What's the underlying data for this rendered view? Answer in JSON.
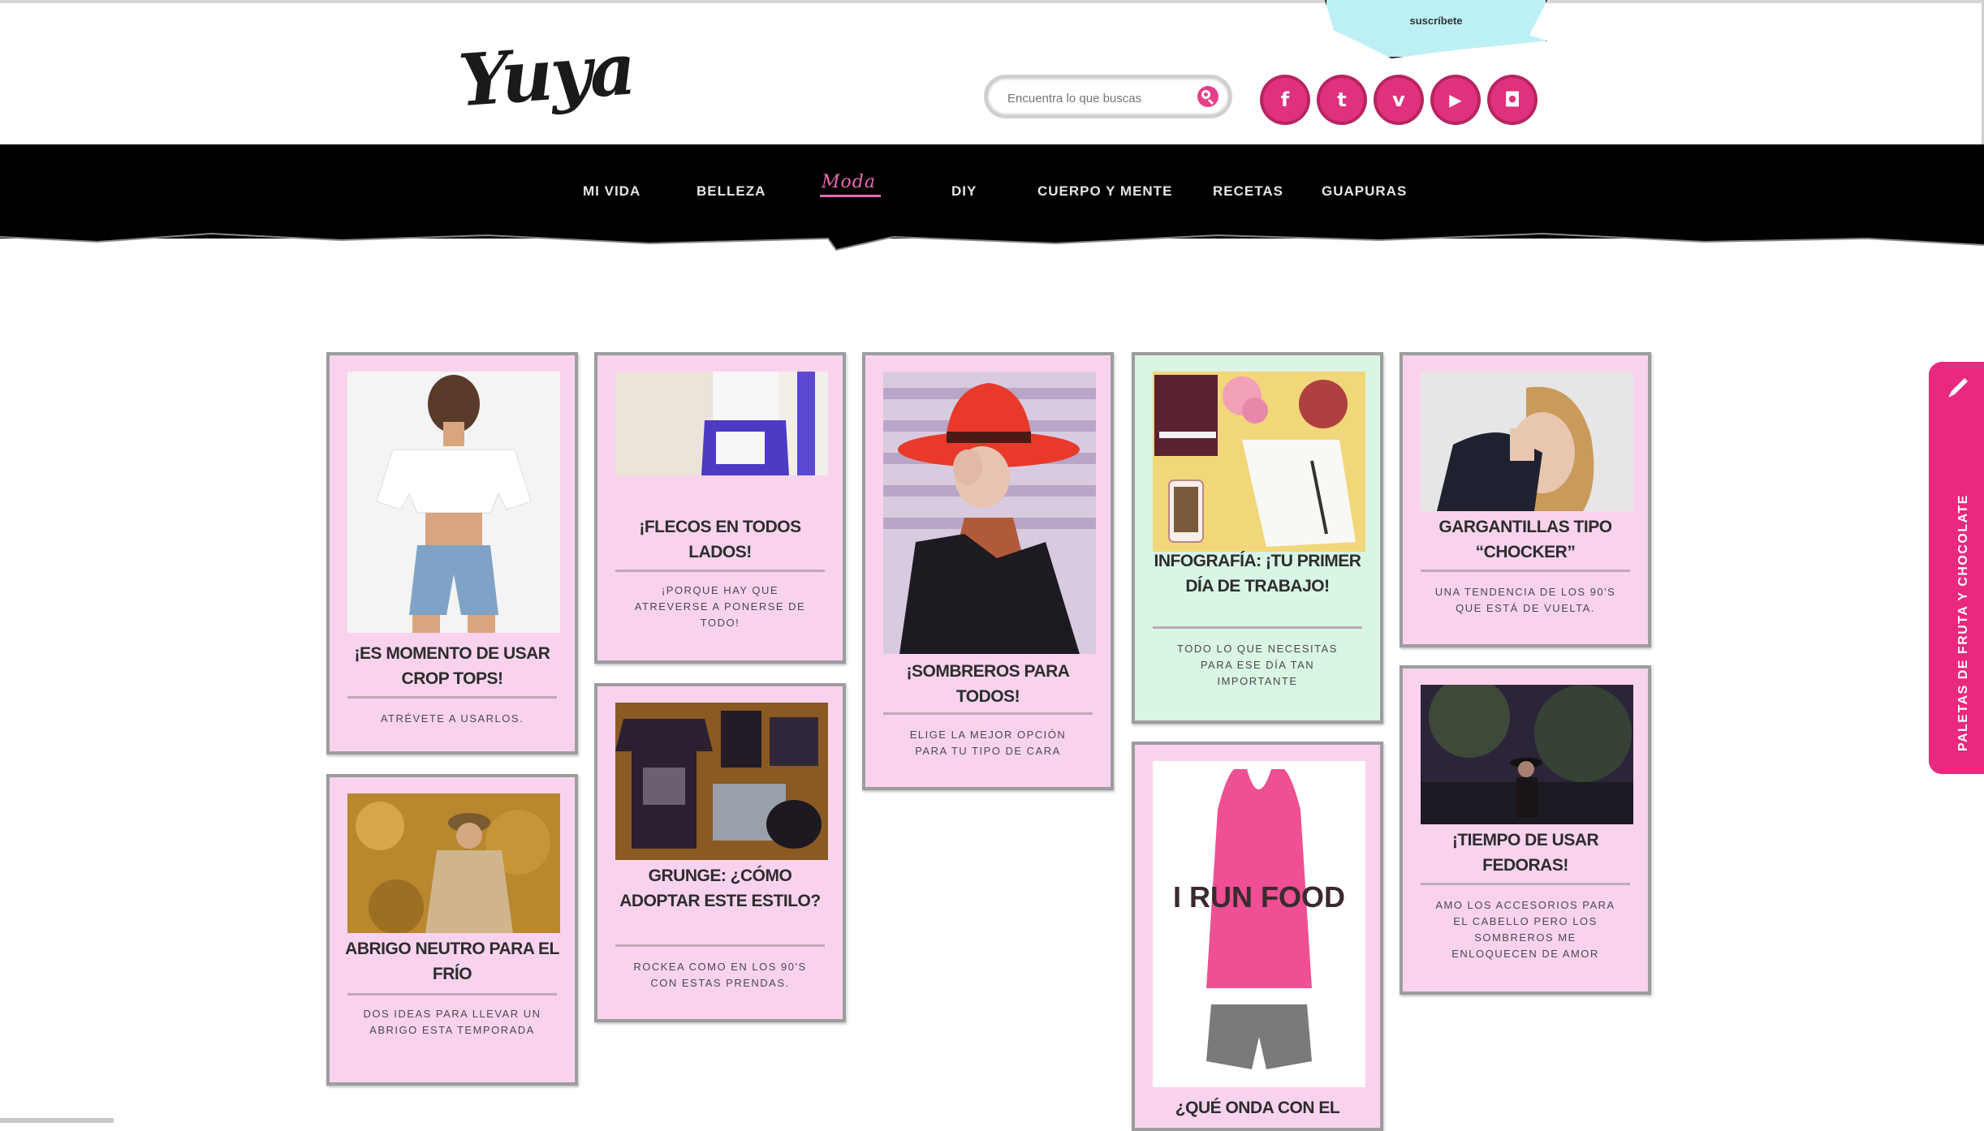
{
  "header": {
    "logo_text": "Yuya",
    "ribbon_text": "suscríbete",
    "search_placeholder": "Encuentra lo que buscas",
    "social": [
      {
        "icon": "facebook-icon",
        "glyph": "f"
      },
      {
        "icon": "twitter-icon",
        "glyph": "t"
      },
      {
        "icon": "vine-icon",
        "glyph": "v"
      },
      {
        "icon": "youtube-icon",
        "glyph": "▶"
      },
      {
        "icon": "instagram-icon",
        "glyph": "◘"
      }
    ]
  },
  "nav": {
    "items": [
      "MI VIDA",
      "BELLEZA",
      "Moda",
      "DIY",
      "CUERPO Y MENTE",
      "RECETAS",
      "GUAPURAS"
    ],
    "active": "Moda"
  },
  "cards": [
    {
      "title": "¡ES MOMENTO DE USAR CROP TOPS!",
      "subtitle": "ATRÉVETE A USARLOS.",
      "image": "crop-top-photo"
    },
    {
      "title": "ABRIGO NEUTRO PARA EL FRÍO",
      "subtitle": "DOS IDEAS PARA LLEVAR UN ABRIGO ESTA TEMPORADA",
      "image": "coat-photo"
    },
    {
      "title": "¡FLECOS EN TODOS LADOS!",
      "subtitle": "¡PORQUE HAY QUE ATREVERSE A PONERSE DE TODO!",
      "image": "fringe-photo"
    },
    {
      "title": "GRUNGE: ¿CÓMO ADOPTAR ESTE ESTILO?",
      "subtitle": "ROCKEA COMO EN LOS 90'S CON ESTAS PRENDAS.",
      "image": "grunge-photo"
    },
    {
      "title": "¡SOMBREROS PARA TODOS!",
      "subtitle": "ELIGE LA MEJOR OPCIÓN PARA TU TIPO DE CARA",
      "image": "hat-photo"
    },
    {
      "title": "INFOGRAFÍA: ¡TU PRIMER DÍA DE TRABAJO!",
      "subtitle": "TODO LO QUE NECESITAS PARA ESE DÍA TAN IMPORTANTE",
      "image": "desk-photo"
    },
    {
      "title": "¿QUÉ ONDA CON EL",
      "subtitle": "",
      "image": "tank-top-photo"
    },
    {
      "title": "GARGANTILLAS TIPO “CHOCKER”",
      "subtitle": "UNA TENDENCIA DE LOS 90'S QUE ESTÁ DE VUELTA.",
      "image": "choker-photo"
    },
    {
      "title": "¡TIEMPO DE USAR FEDORAS!",
      "subtitle": "AMO LOS ACCESORIOS PARA EL CABELLO PERO LOS SOMBREROS ME ENLOQUECEN DE AMOR",
      "image": "fedora-photo"
    }
  ],
  "tank_print": "I RUN FOOD",
  "side_tab": {
    "label": "PALETAS DE FRUTA Y CHOCOLATE"
  },
  "colors": {
    "brand_pink": "#e8297f",
    "card_pink": "#f9d3ee",
    "card_mint": "#d9f5e3",
    "nav_bg": "#000000"
  }
}
